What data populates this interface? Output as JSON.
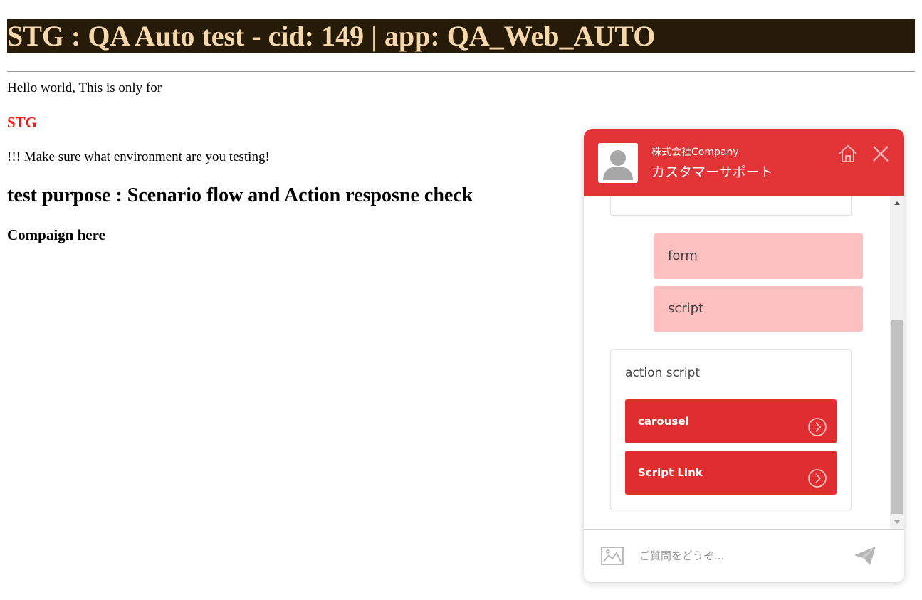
{
  "page": {
    "title": "STG : QA Auto test - cid: 149 | app: QA_Web_AUTO",
    "hello": "Hello world, This is only for",
    "env": "STG",
    "warning": "!!! Make sure what environment are you testing!",
    "purpose": "test purpose : Scenario flow and Action resposne check",
    "campaign": "Compaign here"
  },
  "chat": {
    "company": "株式会社Company",
    "subtitle": "カスタマーサポート",
    "header_color": "#e23337",
    "icons": {
      "avatar": "user-avatar-icon",
      "home": "home-icon",
      "close": "close-icon",
      "image": "image-icon",
      "send": "send-icon"
    },
    "bubbles": [
      {
        "text": "form"
      },
      {
        "text": "script"
      }
    ],
    "action_card": {
      "title": "action script",
      "buttons": [
        {
          "label": "carousel"
        },
        {
          "label": "Script Link"
        }
      ]
    },
    "input": {
      "placeholder": "ご質問をどうぞ...",
      "value": ""
    }
  }
}
